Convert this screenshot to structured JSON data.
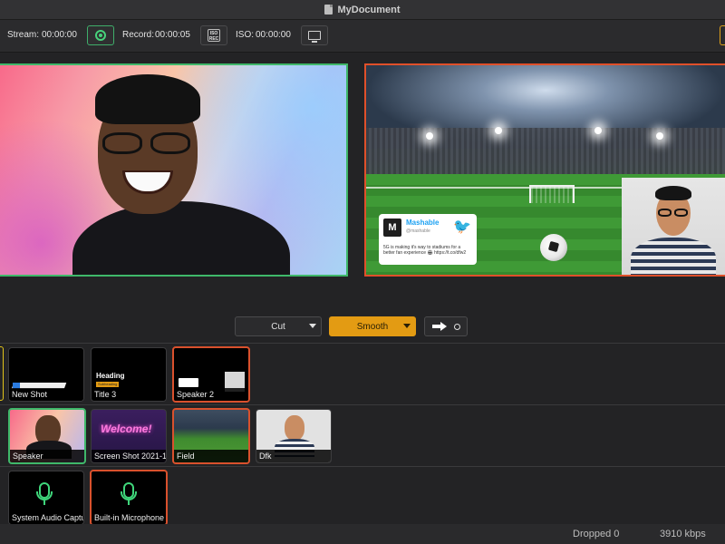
{
  "window": {
    "title": "MyDocument"
  },
  "toolbar": {
    "stream_label": "Stream:",
    "stream_time": "00:00:00",
    "record_label": "Record:",
    "record_time": "00:00:05",
    "iso_icon_text": "ISO REC",
    "iso_label": "ISO:",
    "iso_time": "00:00:00"
  },
  "program": {
    "tweet": {
      "account": "Mashable",
      "handle": "@mashable",
      "text": "5G is making it's way to stadiums for a better fan experience 🏟 https://t.co/dfw2"
    }
  },
  "transitions": {
    "cut_label": "Cut",
    "smooth_label": "Smooth"
  },
  "shots": {
    "row1": [
      {
        "label": "New Shot"
      },
      {
        "label": "Title 3",
        "heading": "Heading",
        "subheading": "Subheading"
      },
      {
        "label": "Speaker 2"
      }
    ],
    "row2": [
      {
        "label": "Speaker"
      },
      {
        "label": "Screen Shot 2021-1",
        "sign": "Welcome!"
      },
      {
        "label": "Field"
      },
      {
        "label": "Dfk"
      }
    ],
    "row3": [
      {
        "label": "System Audio Captu"
      },
      {
        "label": "Built-in Microphone"
      }
    ]
  },
  "status": {
    "dropped": "Dropped 0",
    "bitrate": "3910 kbps"
  },
  "colors": {
    "live_green": "#3fb86a",
    "program_red": "#e0502a",
    "accent_orange": "#e39b13",
    "mic_green": "#3fd67b"
  }
}
